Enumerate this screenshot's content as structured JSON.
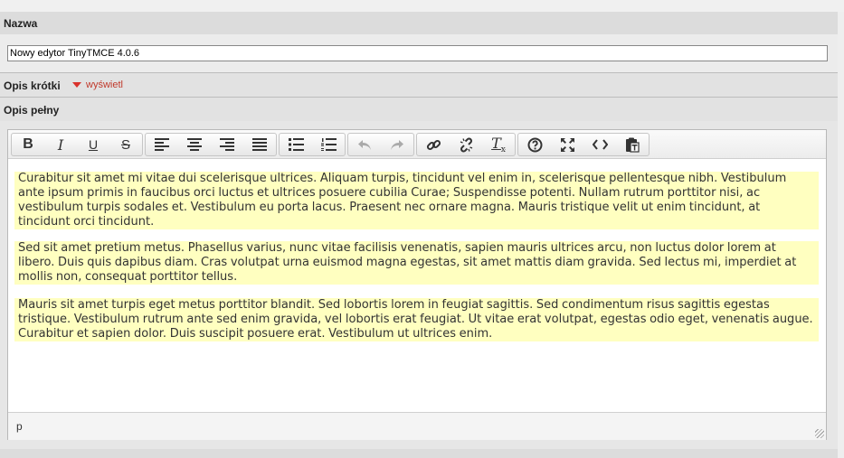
{
  "form": {
    "name_label": "Nazwa",
    "name_value": "Nowy edytor TinyTMCE 4.0.6",
    "short_desc_label": "Opis krótki",
    "short_desc_toggle": "wyświetl",
    "full_desc_label": "Opis pełny"
  },
  "editor": {
    "toolbar_groups": [
      [
        {
          "name": "bold",
          "glyph": "B"
        },
        {
          "name": "italic",
          "glyph": "I"
        },
        {
          "name": "underline",
          "glyph": "U"
        },
        {
          "name": "strikethrough",
          "glyph": "S"
        }
      ],
      [
        {
          "name": "align-left"
        },
        {
          "name": "align-center"
        },
        {
          "name": "align-right"
        },
        {
          "name": "align-justify"
        }
      ],
      [
        {
          "name": "bullet-list"
        },
        {
          "name": "numbered-list"
        }
      ],
      [
        {
          "name": "undo"
        },
        {
          "name": "redo"
        }
      ],
      [
        {
          "name": "link"
        },
        {
          "name": "unlink"
        },
        {
          "name": "remove-format",
          "glyph": "Tx"
        }
      ],
      [
        {
          "name": "help"
        },
        {
          "name": "fullscreen"
        },
        {
          "name": "source-code"
        },
        {
          "name": "paste-text"
        }
      ]
    ],
    "paragraphs": [
      "Curabitur sit amet mi vitae dui scelerisque ultrices. Aliquam  turpis, tincidunt vel enim in, scelerisque pellentesque nibh. Vestibulum ante ipsum primis in faucibus orci luctus et ultrices posuere cubilia Curae; Suspendisse potenti. Nullam rutrum porttitor nisi, ac vestibulum turpis sodales et. Vestibulum eu porta lacus. Praesent nec ornare magna. Mauris tristique velit ut enim tincidunt, at tincidunt orci tincidunt.",
      "Sed sit amet pretium metus. Phasellus varius, nunc vitae facilisis venenatis, sapien mauris ultrices arcu, non luctus dolor lorem at libero. Duis quis dapibus diam. Cras volutpat urna euismod magna egestas, sit amet mattis diam gravida. Sed lectus mi, imperdiet at mollis non, consequat porttitor tellus.",
      "Mauris sit amet turpis eget metus porttitor blandit. Sed lobortis lorem in feugiat sagittis. Sed condimentum risus sagittis egestas tristique. Vestibulum rutrum ante sed enim gravida, vel lobortis erat feugiat. Ut vitae erat volutpat, egestas odio eget, venenatis augue. Curabitur et sapien dolor. Duis suscipit posuere erat. Vestibulum ut ultrices enim."
    ],
    "status_path": "p"
  },
  "colors": {
    "highlight": "#ffffc0",
    "accent": "#d9322c"
  }
}
